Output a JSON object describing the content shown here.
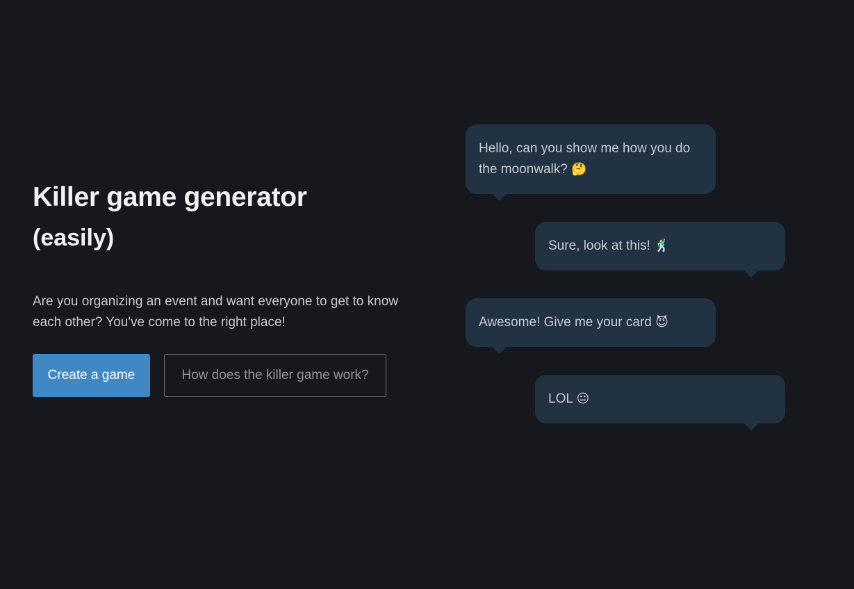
{
  "hero": {
    "title": "Killer game generator",
    "subtitle": "(easily)",
    "intro": "Are you organizing an event and want everyone to get to know each other? You've come to the right place!"
  },
  "actions": {
    "create_label": "Create a game",
    "how_label": "How does the killer game work?"
  },
  "chat": [
    {
      "text": "Hello, can you show me how you do the moonwalk?",
      "emoji": "🤔",
      "emoji_icon": "thinking-face-icon",
      "side": "left"
    },
    {
      "text": "Sure, look at this!",
      "emoji": "🕺",
      "emoji_icon": "dancing-man-icon",
      "side": "right"
    },
    {
      "text": "Awesome! Give me your card",
      "emoji": "😈",
      "emoji_icon": "smiling-devil-icon",
      "side": "left"
    },
    {
      "text": "LOL",
      "emoji": "😐",
      "emoji_icon": "neutral-face-icon",
      "side": "right"
    }
  ],
  "colors": {
    "background": "#16181d",
    "primary": "#3f88c5",
    "bubble": "#213243",
    "heading": "#f1f2f4"
  }
}
